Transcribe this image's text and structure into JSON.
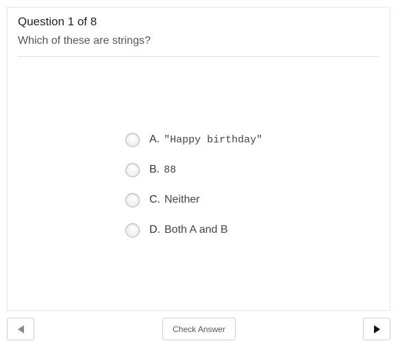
{
  "question": {
    "counter": "Question 1 of 8",
    "prompt": "Which of these are strings?"
  },
  "answers": [
    {
      "letter": "A.",
      "text": "\"Happy birthday\"",
      "monospace": true,
      "selected": false
    },
    {
      "letter": "B.",
      "text": "88",
      "monospace": true,
      "selected": false
    },
    {
      "letter": "C.",
      "text": "Neither",
      "monospace": false,
      "selected": false
    },
    {
      "letter": "D.",
      "text": "Both A and B",
      "monospace": false,
      "selected": false
    }
  ],
  "controls": {
    "check_label": "Check Answer",
    "prev_icon": "triangle-left-icon",
    "next_icon": "triangle-right-icon"
  },
  "colors": {
    "border": "#e4e4e4",
    "text": "#333333",
    "next_arrow": "#111111",
    "prev_arrow": "#8a8a8a"
  }
}
